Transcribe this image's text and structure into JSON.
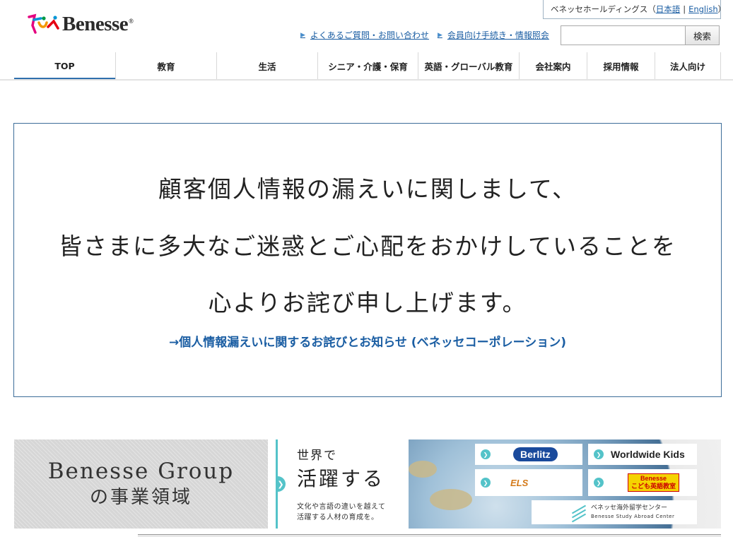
{
  "header": {
    "logo_text": "Benesse",
    "logo_reg": "®",
    "holdings": {
      "label": "ベネッセホールディングス（",
      "japanese": "日本語",
      "sep": "|",
      "english": "English",
      "close": "）"
    },
    "util_links": [
      {
        "label": "よくあるご質問・お問い合わせ"
      },
      {
        "label": "会員向け手続き・情報照会"
      }
    ],
    "search": {
      "placeholder": "",
      "button_label": "検索"
    }
  },
  "nav": {
    "items": [
      {
        "label": "TOP"
      },
      {
        "label": "教育"
      },
      {
        "label": "生活"
      },
      {
        "label": "シニア・介護・保育"
      },
      {
        "label": "英語・グローバル教育"
      },
      {
        "label": "会社案内"
      },
      {
        "label": "採用情報"
      },
      {
        "label": "法人向け"
      }
    ]
  },
  "apology": {
    "line1": "顧客個人情報の漏えいに関しまして、",
    "line2": "皆さまに多大なご迷惑とご心配をおかけしていることを",
    "line3": "心よりお詫び申し上げます。",
    "link": "→個人情報漏えいに関するお詫びとお知らせ (ベネッセコーポレーション)"
  },
  "banners": {
    "group": {
      "line1": "Benesse Group",
      "line2": "の事業領域"
    },
    "global": {
      "line1": "世界で",
      "line2": "活躍する",
      "desc1": "文化や言語の違いを越えて",
      "desc2": "活躍する人材の育成を。"
    },
    "brands": {
      "berlitz": "Berlitz",
      "worldwide_kids": "Worldwide Kids",
      "els": "ELS",
      "kids_english_1": "Benesse",
      "kids_english_2": "こども英語教室",
      "study_abroad_jp": "ベネッセ海外留学センター",
      "study_abroad_en": "Benesse Study Abroad Center"
    }
  },
  "colors": {
    "link": "#1b5ea3",
    "accent_teal": "#54c3c9",
    "nav_active": "#2f6fad",
    "box_border": "#3d6d99"
  },
  "icons": {
    "logo": "benesse-people-icon",
    "link_arrow": "triangle-right-icon",
    "banner_arrow": "chevron-right-icon"
  }
}
